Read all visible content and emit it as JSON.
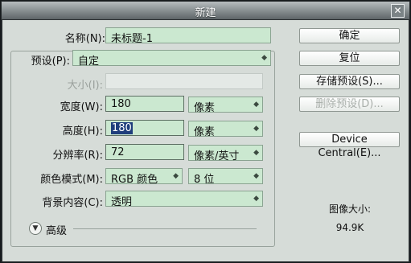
{
  "window": {
    "title": "新建"
  },
  "name": {
    "label": "名称(N):",
    "value": "未标题-1"
  },
  "preset": {
    "label": "预设(P):",
    "value": "自定"
  },
  "size": {
    "label": "大小(I):",
    "value": ""
  },
  "width": {
    "label": "宽度(W):",
    "value": "180",
    "unit": "像素"
  },
  "height": {
    "label": "高度(H):",
    "value": "180",
    "unit": "像素"
  },
  "resolution": {
    "label": "分辨率(R):",
    "value": "72",
    "unit": "像素/英寸"
  },
  "color_mode": {
    "label": "颜色模式(M):",
    "value": "RGB 颜色",
    "depth": "8 位"
  },
  "background": {
    "label": "背景内容(C):",
    "value": "透明"
  },
  "advanced": {
    "label": "高级"
  },
  "buttons": {
    "ok": "确定",
    "reset": "复位",
    "save_preset": "存储预设(S)...",
    "delete_preset": "删除预设(D)...",
    "device_central": "Device Central(E)..."
  },
  "image_size": {
    "label": "图像大小:",
    "value": "94.9K"
  },
  "icons": {
    "close": "close-icon",
    "dropdown": "dropdown-arrows-icon",
    "advanced": "chevron-down-circle-icon"
  }
}
